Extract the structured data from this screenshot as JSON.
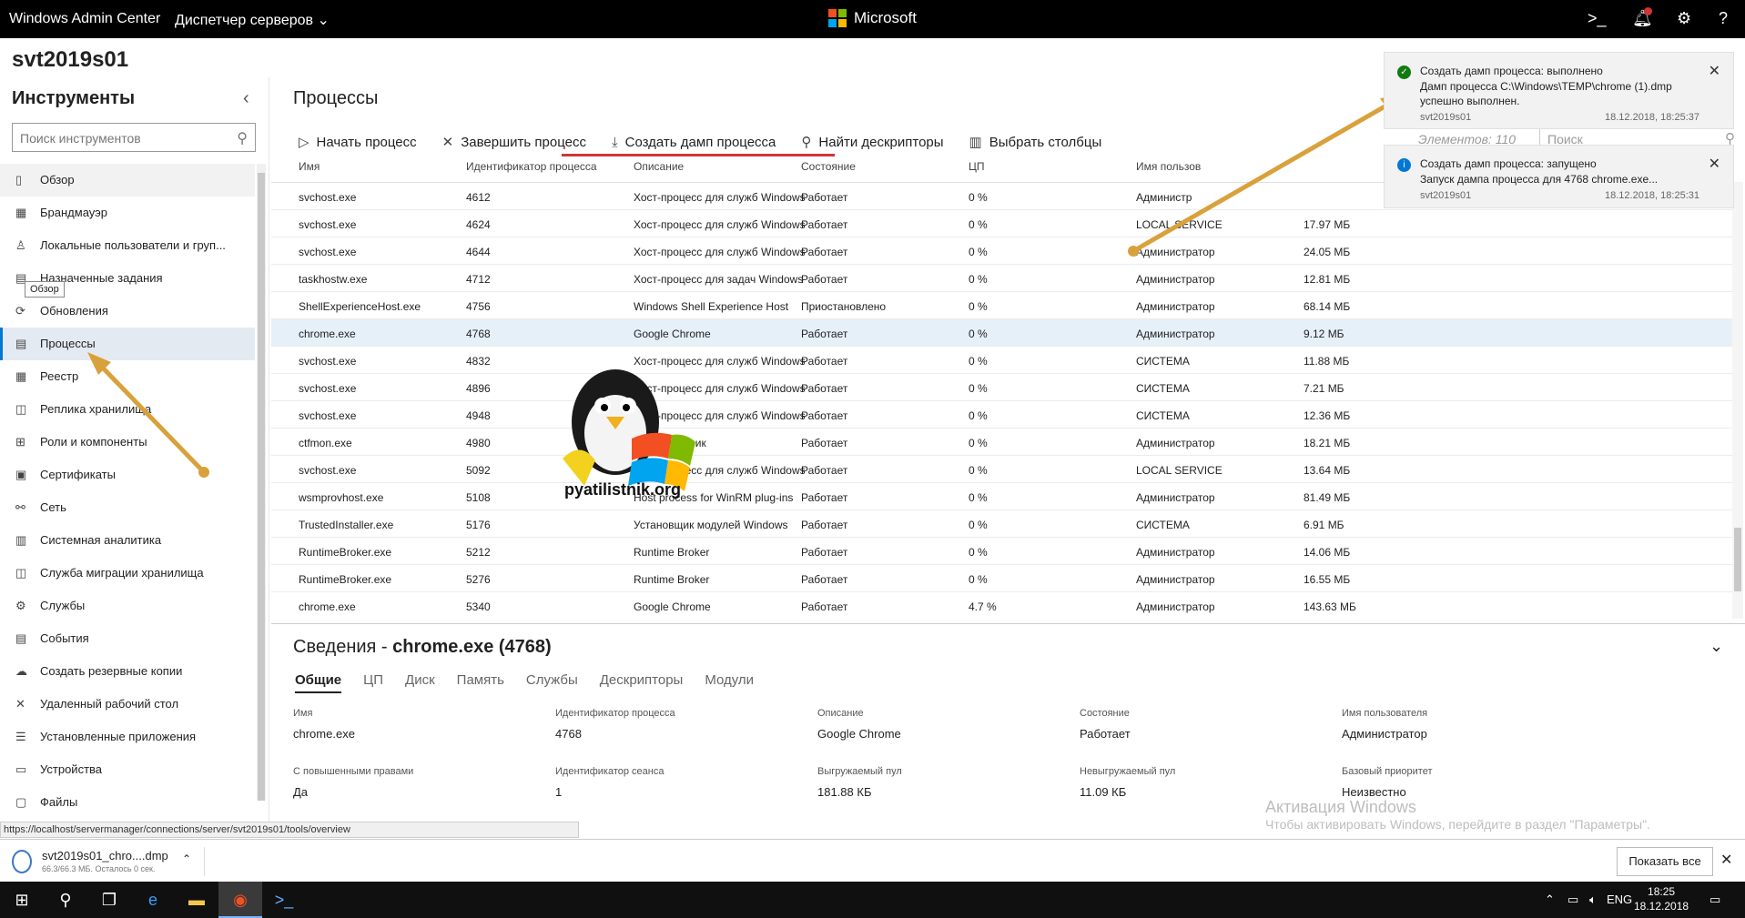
{
  "topbar": {
    "app_title": "Windows Admin Center",
    "server_manager": "Диспетчер серверов",
    "ms_brand": "Microsoft",
    "icons": [
      "terminal-icon",
      "bell-icon",
      "gear-icon",
      "help-icon"
    ]
  },
  "host": "svt2019s01",
  "sidebar": {
    "title": "Инструменты",
    "search_placeholder": "Поиск инструментов",
    "tooltip": "Обзор",
    "items": [
      {
        "label": "Обзор",
        "icon": "▯"
      },
      {
        "label": "Брандмауэр",
        "icon": "▦"
      },
      {
        "label": "Локальные пользователи и груп...",
        "icon": "♙"
      },
      {
        "label": "Назначенные задания",
        "icon": "▤"
      },
      {
        "label": "Обновления",
        "icon": "⟳"
      },
      {
        "label": "Процессы",
        "icon": "▤"
      },
      {
        "label": "Реестр",
        "icon": "▦"
      },
      {
        "label": "Реплика хранилища",
        "icon": "◫"
      },
      {
        "label": "Роли и компоненты",
        "icon": "⊞"
      },
      {
        "label": "Сертификаты",
        "icon": "▣"
      },
      {
        "label": "Сеть",
        "icon": "⚯"
      },
      {
        "label": "Системная аналитика",
        "icon": "▥"
      },
      {
        "label": "Служба миграции хранилища",
        "icon": "◫"
      },
      {
        "label": "Службы",
        "icon": "⚙"
      },
      {
        "label": "События",
        "icon": "▤"
      },
      {
        "label": "Создать резервные копии",
        "icon": "☁"
      },
      {
        "label": "Удаленный рабочий стол",
        "icon": "✕"
      },
      {
        "label": "Установленные приложения",
        "icon": "☰"
      },
      {
        "label": "Устройства",
        "icon": "▭"
      },
      {
        "label": "Файлы",
        "icon": "▢"
      }
    ]
  },
  "main": {
    "title": "Процессы",
    "toolbar": [
      {
        "label": "Начать процесс",
        "icon": "▷"
      },
      {
        "label": "Завершить процесс",
        "icon": "✕"
      },
      {
        "label": "Создать дамп процесса",
        "icon": "⤓"
      },
      {
        "label": "Найти дескрипторы",
        "icon": "⚲"
      },
      {
        "label": "Выбрать столбцы",
        "icon": "▥"
      }
    ],
    "count": "Элементов: 110",
    "search_placeholder": "Поиск",
    "columns": [
      "Имя",
      "Идентификатор процесса",
      "Описание",
      "Состояние",
      "ЦП",
      "Имя пользов",
      ""
    ],
    "rows": [
      {
        "name": "svchost.exe",
        "pid": "4612",
        "desc": "Хост-процесс для служб Windows",
        "state": "Работает",
        "cpu": "0 %",
        "user": "Администр",
        "mem": ""
      },
      {
        "name": "svchost.exe",
        "pid": "4624",
        "desc": "Хост-процесс для служб Windows",
        "state": "Работает",
        "cpu": "0 %",
        "user": "LOCAL SERVICE",
        "mem": "17.97 МБ"
      },
      {
        "name": "svchost.exe",
        "pid": "4644",
        "desc": "Хост-процесс для служб Windows",
        "state": "Работает",
        "cpu": "0 %",
        "user": "Администратор",
        "mem": "24.05 МБ"
      },
      {
        "name": "taskhostw.exe",
        "pid": "4712",
        "desc": "Хост-процесс для задач Windows",
        "state": "Работает",
        "cpu": "0 %",
        "user": "Администратор",
        "mem": "12.81 МБ"
      },
      {
        "name": "ShellExperienceHost.exe",
        "pid": "4756",
        "desc": "Windows Shell Experience Host",
        "state": "Приостановлено",
        "cpu": "0 %",
        "user": "Администратор",
        "mem": "68.14 МБ"
      },
      {
        "name": "chrome.exe",
        "pid": "4768",
        "desc": "Google Chrome",
        "state": "Работает",
        "cpu": "0 %",
        "user": "Администратор",
        "mem": "9.12 МБ",
        "selected": true
      },
      {
        "name": "svchost.exe",
        "pid": "4832",
        "desc": "Хост-процесс для служб Windows",
        "state": "Работает",
        "cpu": "0 %",
        "user": "СИСТЕМА",
        "mem": "11.88 МБ"
      },
      {
        "name": "svchost.exe",
        "pid": "4896",
        "desc": "Хост-процесс для служб Windows",
        "state": "Работает",
        "cpu": "0 %",
        "user": "СИСТЕМА",
        "mem": "7.21 МБ"
      },
      {
        "name": "svchost.exe",
        "pid": "4948",
        "desc": "Хост-процесс для служб Windows",
        "state": "Работает",
        "cpu": "0 %",
        "user": "СИСТЕМА",
        "mem": "12.36 МБ"
      },
      {
        "name": "ctfmon.exe",
        "pid": "4980",
        "desc": "CTF-загрузчик",
        "state": "Работает",
        "cpu": "0 %",
        "user": "Администратор",
        "mem": "18.21 МБ"
      },
      {
        "name": "svchost.exe",
        "pid": "5092",
        "desc": "Хост-процесс для служб Windows",
        "state": "Работает",
        "cpu": "0 %",
        "user": "LOCAL SERVICE",
        "mem": "13.64 МБ"
      },
      {
        "name": "wsmprovhost.exe",
        "pid": "5108",
        "desc": "Host process for WinRM plug-ins",
        "state": "Работает",
        "cpu": "0 %",
        "user": "Администратор",
        "mem": "81.49 МБ"
      },
      {
        "name": "TrustedInstaller.exe",
        "pid": "5176",
        "desc": "Установщик модулей Windows",
        "state": "Работает",
        "cpu": "0 %",
        "user": "СИСТЕМА",
        "mem": "6.91 МБ"
      },
      {
        "name": "RuntimeBroker.exe",
        "pid": "5212",
        "desc": "Runtime Broker",
        "state": "Работает",
        "cpu": "0 %",
        "user": "Администратор",
        "mem": "14.06 МБ"
      },
      {
        "name": "RuntimeBroker.exe",
        "pid": "5276",
        "desc": "Runtime Broker",
        "state": "Работает",
        "cpu": "0 %",
        "user": "Администратор",
        "mem": "16.55 МБ"
      },
      {
        "name": "chrome.exe",
        "pid": "5340",
        "desc": "Google Chrome",
        "state": "Работает",
        "cpu": "4.7 %",
        "user": "Администратор",
        "mem": "143.63 МБ"
      }
    ]
  },
  "details": {
    "title_prefix": "Сведения - ",
    "title_process": "chrome.exe (4768)",
    "tabs": [
      "Общие",
      "ЦП",
      "Диск",
      "Память",
      "Службы",
      "Дескрипторы",
      "Модули"
    ],
    "fields": [
      {
        "label": "Имя",
        "value": "chrome.exe"
      },
      {
        "label": "Идентификатор процесса",
        "value": "4768"
      },
      {
        "label": "Описание",
        "value": "Google Chrome"
      },
      {
        "label": "Состояние",
        "value": "Работает"
      },
      {
        "label": "Имя пользователя",
        "value": "Администратор"
      },
      {
        "label": "С повышенными правами",
        "value": "Да"
      },
      {
        "label": "Идентификатор сеанса",
        "value": "1"
      },
      {
        "label": "Выгружаемый пул",
        "value": "181.88 КБ"
      },
      {
        "label": "Невыгружаемый пул",
        "value": "11.09 КБ"
      },
      {
        "label": "Базовый приоритет",
        "value": "Неизвестно"
      }
    ]
  },
  "toasts": [
    {
      "title": "Создать дамп процесса: выполнено",
      "body": "Дамп процесса C:\\Windows\\TEMP\\chrome (1).dmp успешно выполнен.",
      "host": "svt2019s01",
      "time": "18.12.2018, 18:25:37",
      "status": "success",
      "color": "#107c10"
    },
    {
      "title": "Создать дамп процесса: запущено",
      "body": "Запуск дампа процесса для 4768 chrome.exe...",
      "host": "svt2019s01",
      "time": "18.12.2018, 18:25:31",
      "status": "info",
      "color": "#0078d4"
    }
  ],
  "watermark": {
    "line1": "Активация Windows",
    "line2": "Чтобы активировать Windows, перейдите в раздел \"Параметры\"."
  },
  "statusbar_url": "https://localhost/servermanager/connections/server/svt2019s01/tools/overview",
  "download": {
    "name": "svt2019s01_chro....dmp",
    "sub": "66.3/66.3 МБ. Осталось 0 сек.",
    "show_all": "Показать все"
  },
  "taskbar": {
    "lang": "ENG",
    "time": "18:25",
    "date": "18.12.2018"
  },
  "colors": {
    "accent": "#0078d4",
    "topbar": "#000000",
    "selected_row": "#e6f0f8",
    "annotation_arrow": "#d9a13b",
    "underline": "#d13438"
  }
}
